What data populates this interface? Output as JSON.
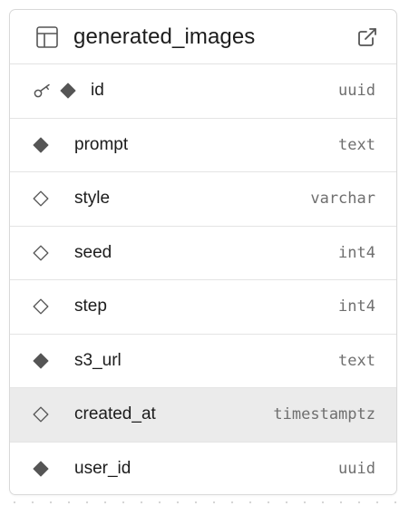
{
  "table": {
    "name": "generated_images",
    "icon": "table-icon",
    "open_icon": "external-link-icon",
    "columns": [
      {
        "name": "id",
        "type": "uuid",
        "primary_key": true,
        "nullable": false
      },
      {
        "name": "prompt",
        "type": "text",
        "primary_key": false,
        "nullable": false
      },
      {
        "name": "style",
        "type": "varchar",
        "primary_key": false,
        "nullable": true
      },
      {
        "name": "seed",
        "type": "int4",
        "primary_key": false,
        "nullable": true
      },
      {
        "name": "step",
        "type": "int4",
        "primary_key": false,
        "nullable": true
      },
      {
        "name": "s3_url",
        "type": "text",
        "primary_key": false,
        "nullable": false
      },
      {
        "name": "created_at",
        "type": "timestamptz",
        "primary_key": false,
        "nullable": true,
        "highlighted": true
      },
      {
        "name": "user_id",
        "type": "uuid",
        "primary_key": false,
        "nullable": false
      }
    ]
  },
  "colors": {
    "text": "#1c1c1c",
    "muted": "#6f6f6f",
    "icon": "#555555",
    "border": "#d9d9d9",
    "highlight": "#ebebeb"
  }
}
